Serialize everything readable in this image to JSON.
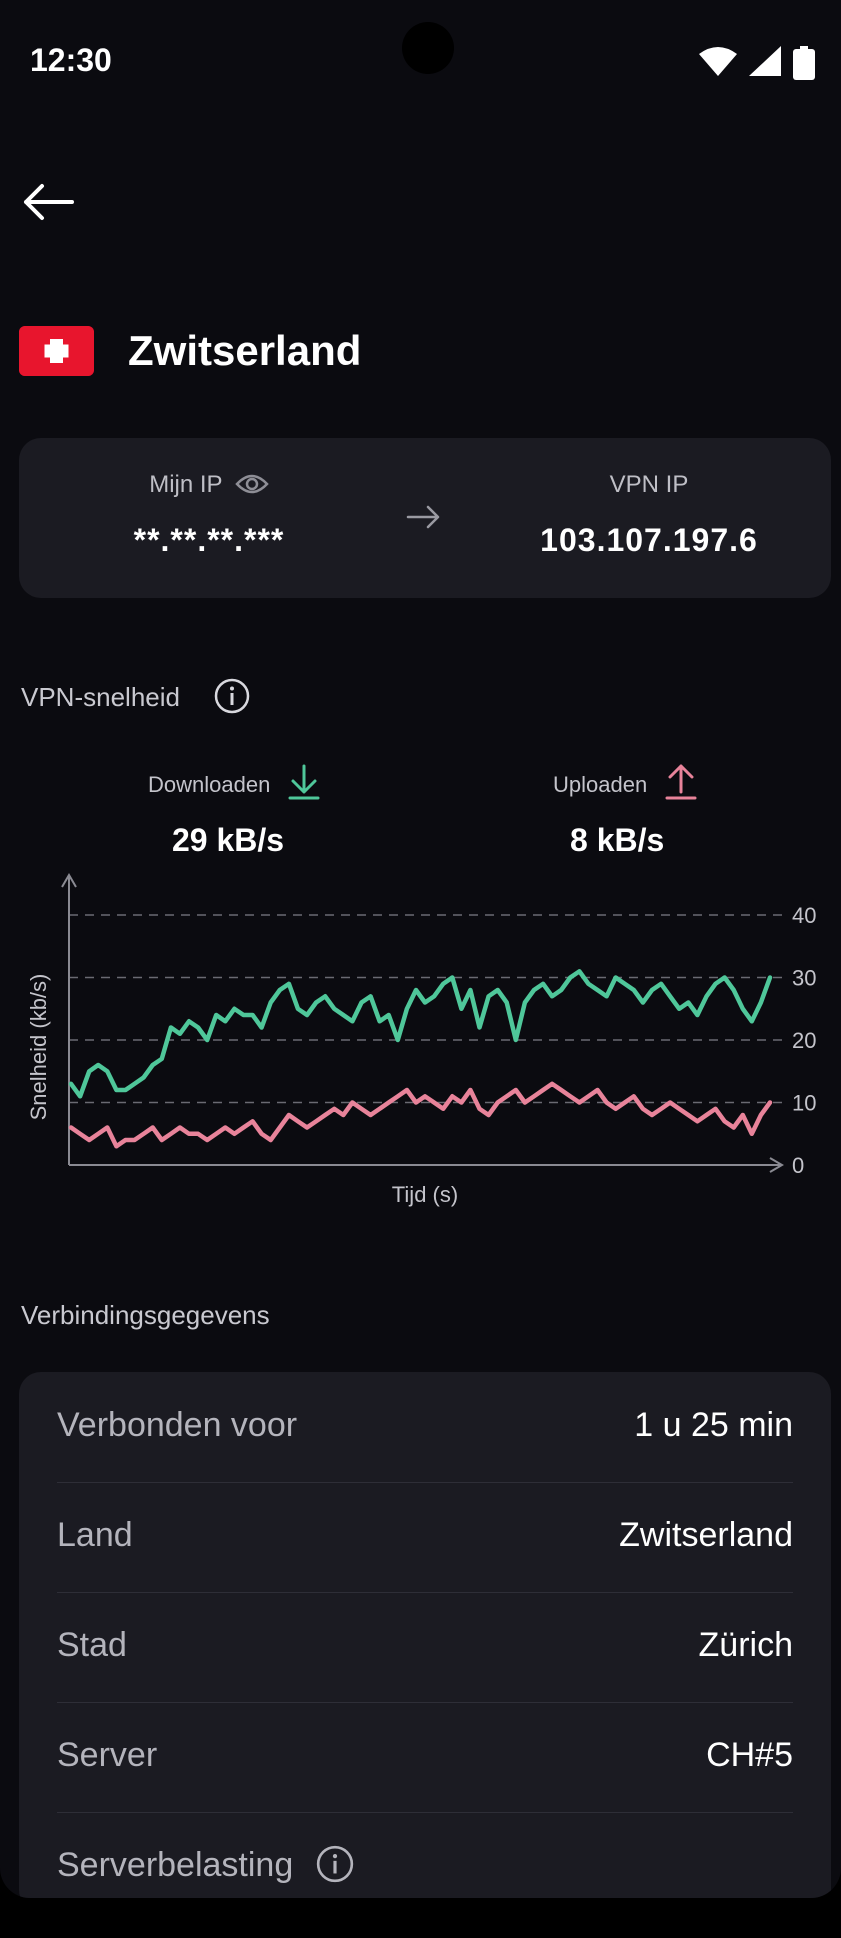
{
  "status_bar": {
    "time": "12:30"
  },
  "header": {
    "country": "Zwitserland"
  },
  "ip_card": {
    "my_ip_label": "Mijn IP",
    "my_ip_value": "**.**.**.***",
    "vpn_ip_label": "VPN IP",
    "vpn_ip_value": "103.107.197.6"
  },
  "speed": {
    "section_title": "VPN-snelheid",
    "download_label": "Downloaden",
    "download_value": "29 kB/s",
    "upload_label": "Uploaden",
    "upload_value": "8 kB/s"
  },
  "colors": {
    "download": "#4fc79a",
    "upload": "#e8839a",
    "card": "#1b1b22",
    "flag": "#e8152d"
  },
  "chart_data": {
    "type": "line",
    "xlabel": "Tijd (s)",
    "ylabel": "Snelheid (kb/s)",
    "ylim": [
      0,
      40
    ],
    "yticks": [
      "0",
      "10",
      "20",
      "30",
      "40"
    ],
    "grid": true,
    "series": [
      {
        "values": [
          13,
          11,
          15,
          16,
          15,
          12,
          12,
          13,
          14,
          16,
          17,
          22,
          21,
          23,
          22,
          20,
          24,
          23,
          25,
          24,
          24,
          22,
          26,
          28,
          29,
          25,
          24,
          26,
          27,
          25,
          24,
          23,
          26,
          27,
          23,
          24,
          20,
          25,
          28,
          26,
          27,
          29,
          30,
          25,
          28,
          22,
          27,
          28,
          26,
          20,
          26,
          28,
          29,
          27,
          28,
          30,
          31,
          29,
          28,
          27,
          30,
          29,
          28,
          26,
          28,
          29,
          27,
          25,
          26,
          24,
          27,
          29,
          30,
          28,
          25,
          23,
          26,
          30
        ]
      },
      {
        "values": [
          6,
          5,
          4,
          5,
          6,
          3,
          4,
          4,
          5,
          6,
          4,
          5,
          6,
          5,
          5,
          4,
          5,
          6,
          5,
          6,
          7,
          5,
          4,
          6,
          8,
          7,
          6,
          7,
          8,
          9,
          8,
          10,
          9,
          8,
          9,
          10,
          11,
          12,
          10,
          11,
          10,
          9,
          11,
          10,
          12,
          9,
          8,
          10,
          11,
          12,
          10,
          11,
          12,
          13,
          12,
          11,
          10,
          11,
          12,
          10,
          9,
          10,
          11,
          9,
          8,
          9,
          10,
          9,
          8,
          7,
          8,
          9,
          7,
          6,
          8,
          5,
          8,
          10
        ]
      }
    ]
  },
  "details": {
    "title": "Verbindingsgegevens",
    "rows": [
      {
        "key": "Verbonden voor",
        "value": "1 u 25 min"
      },
      {
        "key": "Land",
        "value": "Zwitserland"
      },
      {
        "key": "Stad",
        "value": "Zürich"
      },
      {
        "key": "Server",
        "value": "CH#5"
      },
      {
        "key": "Serverbelasting",
        "value": ""
      }
    ]
  }
}
